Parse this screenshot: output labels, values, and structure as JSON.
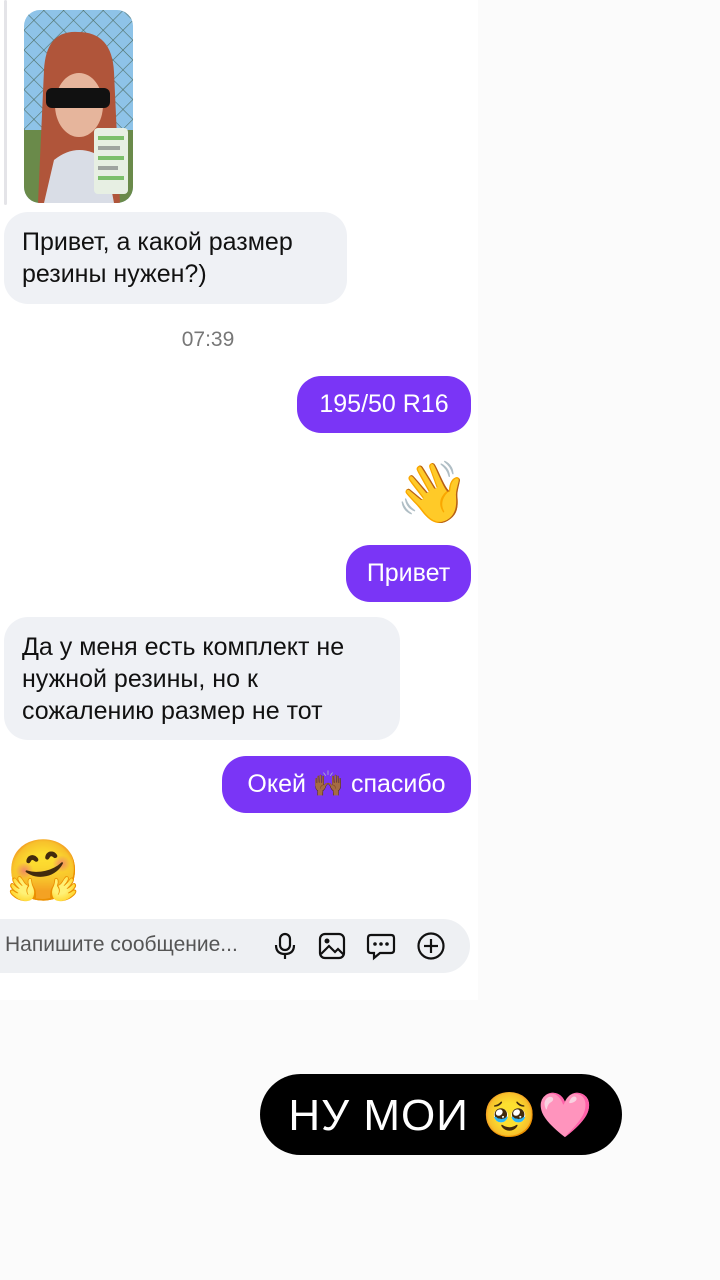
{
  "messages": {
    "incoming_1": "Привет, а какой размер резины нужен?)",
    "timestamp": "07:39",
    "outgoing_1": "195/50 R16",
    "outgoing_emoji": "👋",
    "outgoing_2": "Привет",
    "incoming_2": "Да у меня есть комплект не нужной резины, но к сожалению размер не тот",
    "outgoing_3": "Окей 🙌🏾 спасибо",
    "incoming_emoji": "🤗"
  },
  "composer": {
    "placeholder": "Напишите сообщение...",
    "icons": [
      "microphone-icon",
      "image-icon",
      "chat-bubble-icon",
      "plus-circle-icon"
    ]
  },
  "overlay": {
    "text": "НУ МОИ 🥹🩷"
  },
  "colors": {
    "outgoing_bubble": "#7a35f6",
    "incoming_bubble": "#eff1f5",
    "overlay_bg": "#000000"
  }
}
